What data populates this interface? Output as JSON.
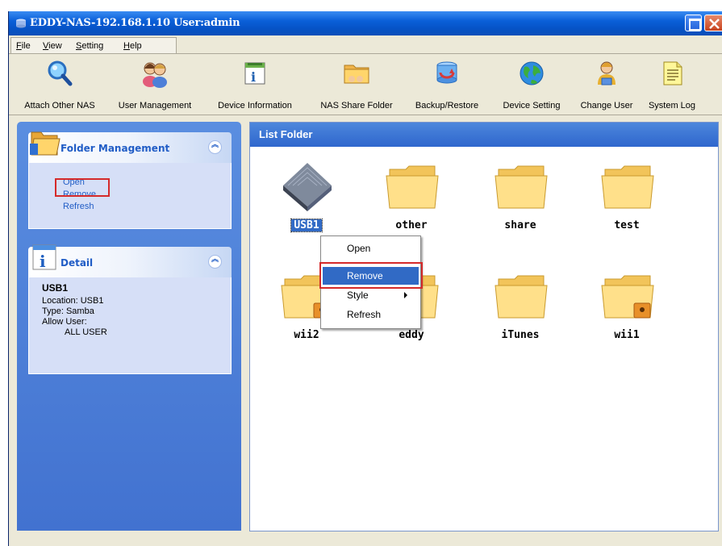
{
  "window": {
    "title": "EDDY-NAS-192.168.1.10 User:admin"
  },
  "menu": {
    "items": [
      {
        "label": "File",
        "accel": "F"
      },
      {
        "label": "View",
        "accel": "V"
      },
      {
        "label": "Setting",
        "accel": "S"
      },
      {
        "label": "Help",
        "accel": "H"
      }
    ]
  },
  "toolbar": {
    "buttons": [
      {
        "label": "Attach Other NAS",
        "icon": "magnifier-icon"
      },
      {
        "label": "User Management",
        "icon": "users-icon"
      },
      {
        "label": "Device Information",
        "icon": "device-info-icon"
      },
      {
        "label": "NAS Share Folder",
        "icon": "share-folder-icon"
      },
      {
        "label": "Backup/Restore",
        "icon": "backup-icon"
      },
      {
        "label": "Device Setting",
        "icon": "globe-icon"
      },
      {
        "label": "Change User",
        "icon": "change-user-icon"
      },
      {
        "label": "System Log",
        "icon": "log-icon"
      }
    ]
  },
  "folder_management": {
    "title": "Folder Management",
    "links": [
      "Open",
      "Remove",
      "Refresh"
    ]
  },
  "detail": {
    "title": "Detail",
    "name": "USB1",
    "location": "Location: USB1",
    "type": "Type: Samba",
    "allow_user_label": "Allow User:",
    "allow_user_value": "ALL USER"
  },
  "list_folder": {
    "title": "List Folder",
    "items": [
      {
        "name": "USB1",
        "kind": "usb-drive",
        "selected": true
      },
      {
        "name": "other",
        "kind": "folder"
      },
      {
        "name": "share",
        "kind": "folder"
      },
      {
        "name": "test",
        "kind": "folder"
      },
      {
        "name": "wii2",
        "kind": "locked-folder"
      },
      {
        "name": "eddy",
        "kind": "folder"
      },
      {
        "name": "iTunes",
        "kind": "folder"
      },
      {
        "name": "wii1",
        "kind": "locked-folder"
      }
    ]
  },
  "context_menu": {
    "items": [
      {
        "label": "Open"
      },
      {
        "label": "Remove",
        "highlighted": true
      },
      {
        "label": "Style",
        "submenu": true
      },
      {
        "label": "Refresh"
      }
    ]
  }
}
